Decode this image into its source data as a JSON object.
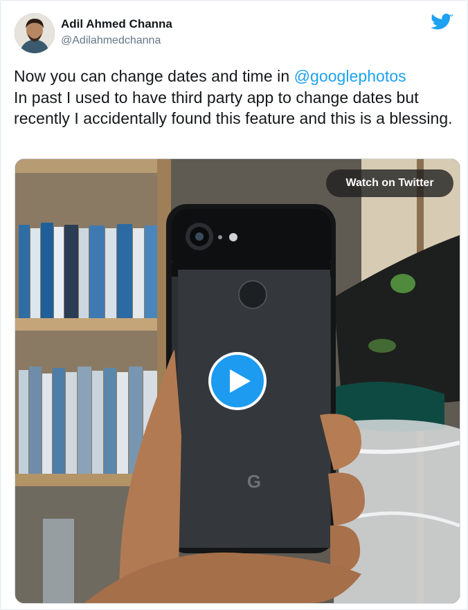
{
  "author": {
    "name": "Adil Ahmed Channa",
    "handle": "@Adilahmedchanna"
  },
  "tweet": {
    "text_before_mention": "Now you can change dates and time in ",
    "mention": "@googlephotos",
    "text_after_mention": "In past I used to have third party app to change dates but recently I accidentally found this feature and this is a blessing."
  },
  "media": {
    "watch_label": "Watch on Twitter"
  },
  "colors": {
    "brand": "#1da1f2",
    "text": "#14171a",
    "secondary": "#657786"
  },
  "icons": {
    "logo": "twitter-bird-icon",
    "play": "play-icon"
  }
}
